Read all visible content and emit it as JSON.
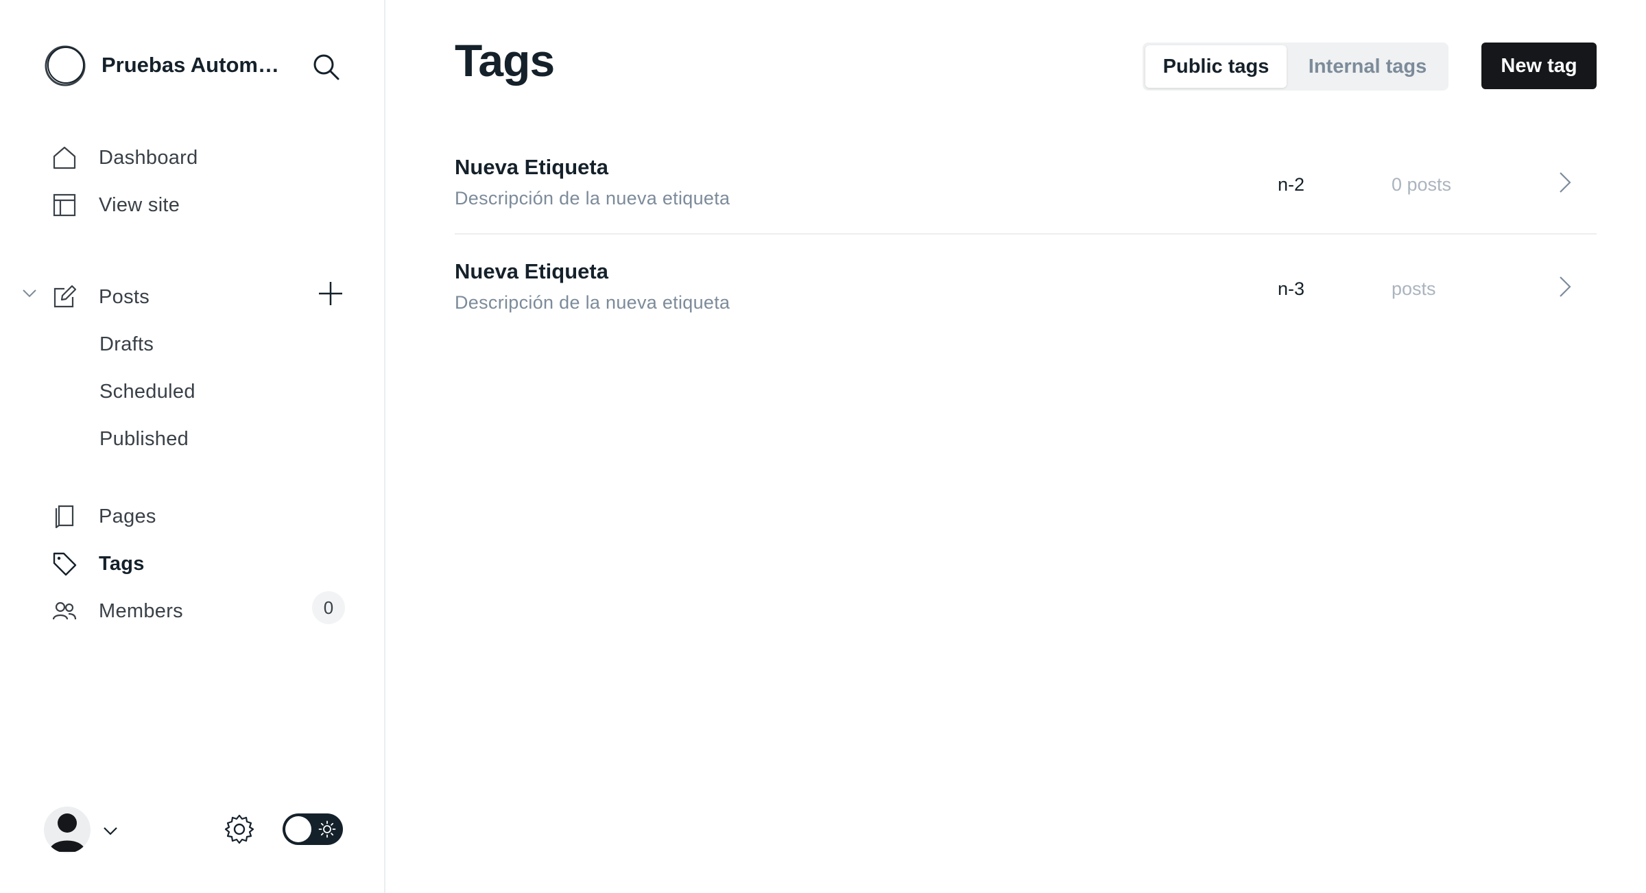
{
  "sidebar": {
    "site_name": "Pruebas Automa...",
    "nav": {
      "dashboard": "Dashboard",
      "view_site": "View site",
      "posts": "Posts",
      "drafts": "Drafts",
      "scheduled": "Scheduled",
      "published": "Published",
      "pages": "Pages",
      "tags": "Tags",
      "members": "Members",
      "members_count": "0"
    },
    "active_item": "Tags"
  },
  "header": {
    "title": "Tags",
    "tabs": [
      {
        "label": "Public tags",
        "selected": true
      },
      {
        "label": "Internal tags",
        "selected": false
      }
    ],
    "new_tag_label": "New tag"
  },
  "tags": [
    {
      "name": "Nueva Etiqueta",
      "description": "Descripción de la nueva etiqueta",
      "slug": "n-2",
      "count": "0 posts"
    },
    {
      "name": "Nueva Etiqueta",
      "description": "Descripción de la nueva etiqueta",
      "slug": "n-3",
      "count": "posts"
    }
  ],
  "icons": [
    "brand-logo-icon",
    "search-icon",
    "home-icon",
    "layout-icon",
    "pencil-icon",
    "chevron-down-icon",
    "plus-icon",
    "page-icon",
    "tag-icon",
    "members-icon",
    "user-icon",
    "gear-icon",
    "sun-icon",
    "chevron-right-icon"
  ],
  "colors": {
    "accent_dark": "#15171a",
    "muted_text": "#7c8b9a",
    "count_text": "#abb4be",
    "divider": "#ebeef0"
  }
}
